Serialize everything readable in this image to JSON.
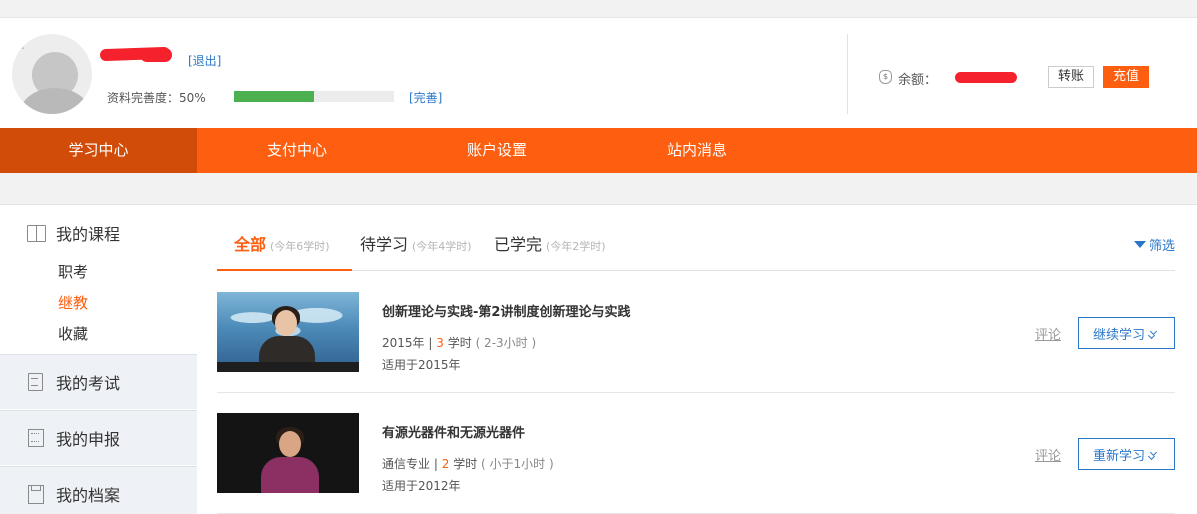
{
  "header": {
    "logout_label": "[退出]",
    "profile_label": "资料完善度：50%",
    "profile_progress": 0.5,
    "complete_link": "[完善]",
    "balance_label": "余额：",
    "transfer_label": "转账",
    "recharge_label": "充值"
  },
  "nav": {
    "items": [
      {
        "label": "学习中心"
      },
      {
        "label": "支付中心"
      },
      {
        "label": "账户设置"
      },
      {
        "label": "站内消息"
      }
    ]
  },
  "sidebar": {
    "my_courses": "我的课程",
    "sub_items": [
      {
        "label": "职考"
      },
      {
        "label": "继教"
      },
      {
        "label": "收藏"
      }
    ],
    "my_exams": "我的考试",
    "my_declare": "我的申报",
    "my_archive": "我的档案"
  },
  "tabs": [
    {
      "label": "全部",
      "count": "(今年6学时)"
    },
    {
      "label": "待学习",
      "count": "(今年4学时)"
    },
    {
      "label": "已学完",
      "count": "(今年2学时)"
    }
  ],
  "filter_label": "筛选",
  "courses": [
    {
      "title": "创新理论与实践-第2讲制度创新理论与实践",
      "meta_prefix": "2015年",
      "hours": "3",
      "hours_unit": "学时",
      "duration": "( 2-3小时 )",
      "apply": "适用于2015年",
      "comment": "评论",
      "action": "继续学习"
    },
    {
      "title": "有源光器件和无源光器件",
      "meta_prefix": "通信专业",
      "hours": "2",
      "hours_unit": "学时",
      "duration": "( 小于1小时 )",
      "apply": "适用于2012年",
      "comment": "评论",
      "action": "重新学习"
    }
  ]
}
